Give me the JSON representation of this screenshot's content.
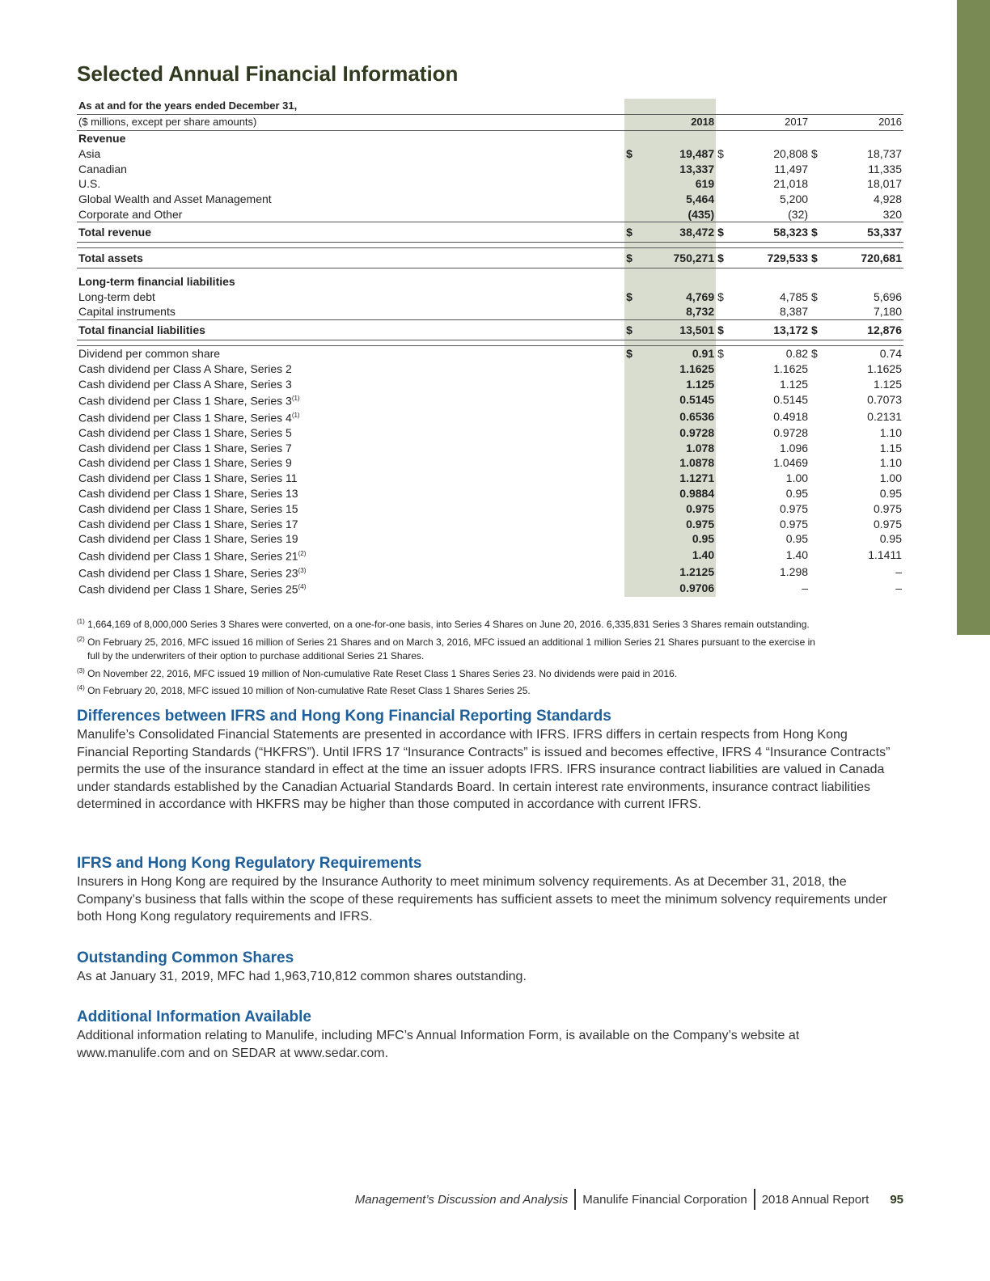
{
  "page": {
    "title": "Selected Annual Financial Information"
  },
  "table": {
    "header_line1": "As at and for the years ended December 31,",
    "header_line2": "($ millions, except per share amounts)",
    "years": [
      "2018",
      "2017",
      "2016"
    ],
    "sections": [
      {
        "heading": "Revenue",
        "rows": [
          {
            "label": "Asia",
            "dollar": true,
            "values": [
              "19,487",
              "20,808",
              "18,737"
            ]
          },
          {
            "label": "Canadian",
            "values": [
              "13,337",
              "11,497",
              "11,335"
            ]
          },
          {
            "label": "U.S.",
            "values": [
              "619",
              "21,018",
              "18,017"
            ]
          },
          {
            "label": "Global Wealth and Asset Management",
            "values": [
              "5,464",
              "5,200",
              "4,928"
            ]
          },
          {
            "label": "Corporate and Other",
            "values": [
              "(435)",
              "(32)",
              "320"
            ]
          }
        ],
        "total": {
          "label": "Total revenue",
          "values": [
            "38,472",
            "58,323",
            "53,337"
          ]
        }
      },
      {
        "total_only": {
          "label": "Total assets",
          "values": [
            "750,271",
            "729,533",
            "720,681"
          ]
        }
      },
      {
        "heading": "Long-term financial liabilities",
        "rows": [
          {
            "label": "Long-term debt",
            "dollar": true,
            "values": [
              "4,769",
              "4,785",
              "5,696"
            ]
          },
          {
            "label": "Capital instruments",
            "values": [
              "8,732",
              "8,387",
              "7,180"
            ]
          }
        ],
        "total": {
          "label": "Total financial liabilities",
          "values": [
            "13,501",
            "13,172",
            "12,876"
          ]
        }
      }
    ],
    "dividends": [
      {
        "label": "Dividend per common share",
        "dollar": true,
        "values": [
          "0.91",
          "0.82",
          "0.74"
        ]
      },
      {
        "label": "Cash dividend per Class A Share, Series 2",
        "values": [
          "1.1625",
          "1.1625",
          "1.1625"
        ]
      },
      {
        "label": "Cash dividend per Class A Share, Series 3",
        "values": [
          "1.125",
          "1.125",
          "1.125"
        ]
      },
      {
        "label": "Cash dividend per Class 1 Share, Series 3",
        "sup": "(1)",
        "values": [
          "0.5145",
          "0.5145",
          "0.7073"
        ]
      },
      {
        "label": "Cash dividend per Class 1 Share, Series 4",
        "sup": "(1)",
        "values": [
          "0.6536",
          "0.4918",
          "0.2131"
        ]
      },
      {
        "label": "Cash dividend per Class 1 Share, Series 5",
        "values": [
          "0.9728",
          "0.9728",
          "1.10"
        ]
      },
      {
        "label": "Cash dividend per Class 1 Share, Series 7",
        "values": [
          "1.078",
          "1.096",
          "1.15"
        ]
      },
      {
        "label": "Cash dividend per Class 1 Share, Series 9",
        "values": [
          "1.0878",
          "1.0469",
          "1.10"
        ]
      },
      {
        "label": "Cash dividend per Class 1 Share, Series 11",
        "values": [
          "1.1271",
          "1.00",
          "1.00"
        ]
      },
      {
        "label": "Cash dividend per Class 1 Share, Series 13",
        "values": [
          "0.9884",
          "0.95",
          "0.95"
        ]
      },
      {
        "label": "Cash dividend per Class 1 Share, Series 15",
        "values": [
          "0.975",
          "0.975",
          "0.975"
        ]
      },
      {
        "label": "Cash dividend per Class 1 Share, Series 17",
        "values": [
          "0.975",
          "0.975",
          "0.975"
        ]
      },
      {
        "label": "Cash dividend per Class 1 Share, Series 19",
        "values": [
          "0.95",
          "0.95",
          "0.95"
        ]
      },
      {
        "label": "Cash dividend per Class 1 Share, Series 21",
        "sup": "(2)",
        "values": [
          "1.40",
          "1.40",
          "1.1411"
        ]
      },
      {
        "label": "Cash dividend per Class 1 Share, Series 23",
        "sup": "(3)",
        "values": [
          "1.2125",
          "1.298",
          "–"
        ]
      },
      {
        "label": "Cash dividend per Class 1 Share, Series 25",
        "sup": "(4)",
        "values": [
          "0.9706",
          "–",
          "–"
        ]
      }
    ]
  },
  "footnotes": [
    {
      "marker": "(1)",
      "text": "1,664,169 of 8,000,000 Series 3 Shares were converted, on a one-for-one basis, into Series 4 Shares on June 20, 2016. 6,335,831 Series 3 Shares remain outstanding."
    },
    {
      "marker": "(2)",
      "text": "On February 25, 2016, MFC issued 16 million of Series 21 Shares and on March 3, 2016, MFC issued an additional 1 million Series 21 Shares pursuant to the exercise in",
      "cont": "full by the underwriters of their option to purchase additional Series 21 Shares."
    },
    {
      "marker": "(3)",
      "text": "On November 22, 2016, MFC issued 19 million of Non-cumulative Rate Reset Class 1 Shares Series 23. No dividends were paid in 2016."
    },
    {
      "marker": "(4)",
      "text": "On February 20, 2018, MFC issued 10 million of Non-cumulative Rate Reset Class 1 Shares Series 25."
    }
  ],
  "sections": [
    {
      "heading": "Differences between IFRS and Hong Kong Financial Reporting Standards",
      "body": "Manulife’s Consolidated Financial Statements are presented in accordance with IFRS. IFRS differs in certain respects from Hong Kong Financial Reporting Standards (“HKFRS”). Until IFRS 17 “Insurance Contracts” is issued and becomes effective, IFRS 4 “Insurance Contracts” permits the use of the insurance standard in effect at the time an issuer adopts IFRS. IFRS insurance contract liabilities are valued in Canada under standards established by the Canadian Actuarial Standards Board. In certain interest rate environments, insurance contract liabilities determined in accordance with HKFRS may be higher than those computed in accordance with current IFRS."
    },
    {
      "heading": "IFRS and Hong Kong Regulatory Requirements",
      "body": "Insurers in Hong Kong are required by the Insurance Authority to meet minimum solvency requirements. As at December 31, 2018, the Company’s business that falls within the scope of these requirements has sufficient assets to meet the minimum solvency requirements under both Hong Kong regulatory requirements and IFRS."
    },
    {
      "heading": "Outstanding Common Shares",
      "body": "As at January 31, 2019, MFC had 1,963,710,812 common shares outstanding."
    },
    {
      "heading": "Additional Information Available",
      "body": "Additional information relating to Manulife, including MFC’s Annual Information Form, is available on the Company’s website at www.manulife.com and on SEDAR at www.sedar.com."
    }
  ],
  "footer": {
    "section": "Management’s Discussion and Analysis",
    "company": "Manulife Financial Corporation",
    "report": "2018 Annual Report",
    "page_number": "95"
  },
  "colors": {
    "sidebar": "#7a8a55",
    "heading_blue": "#1f5f9a",
    "current_year_column": "#d8ddd0"
  }
}
